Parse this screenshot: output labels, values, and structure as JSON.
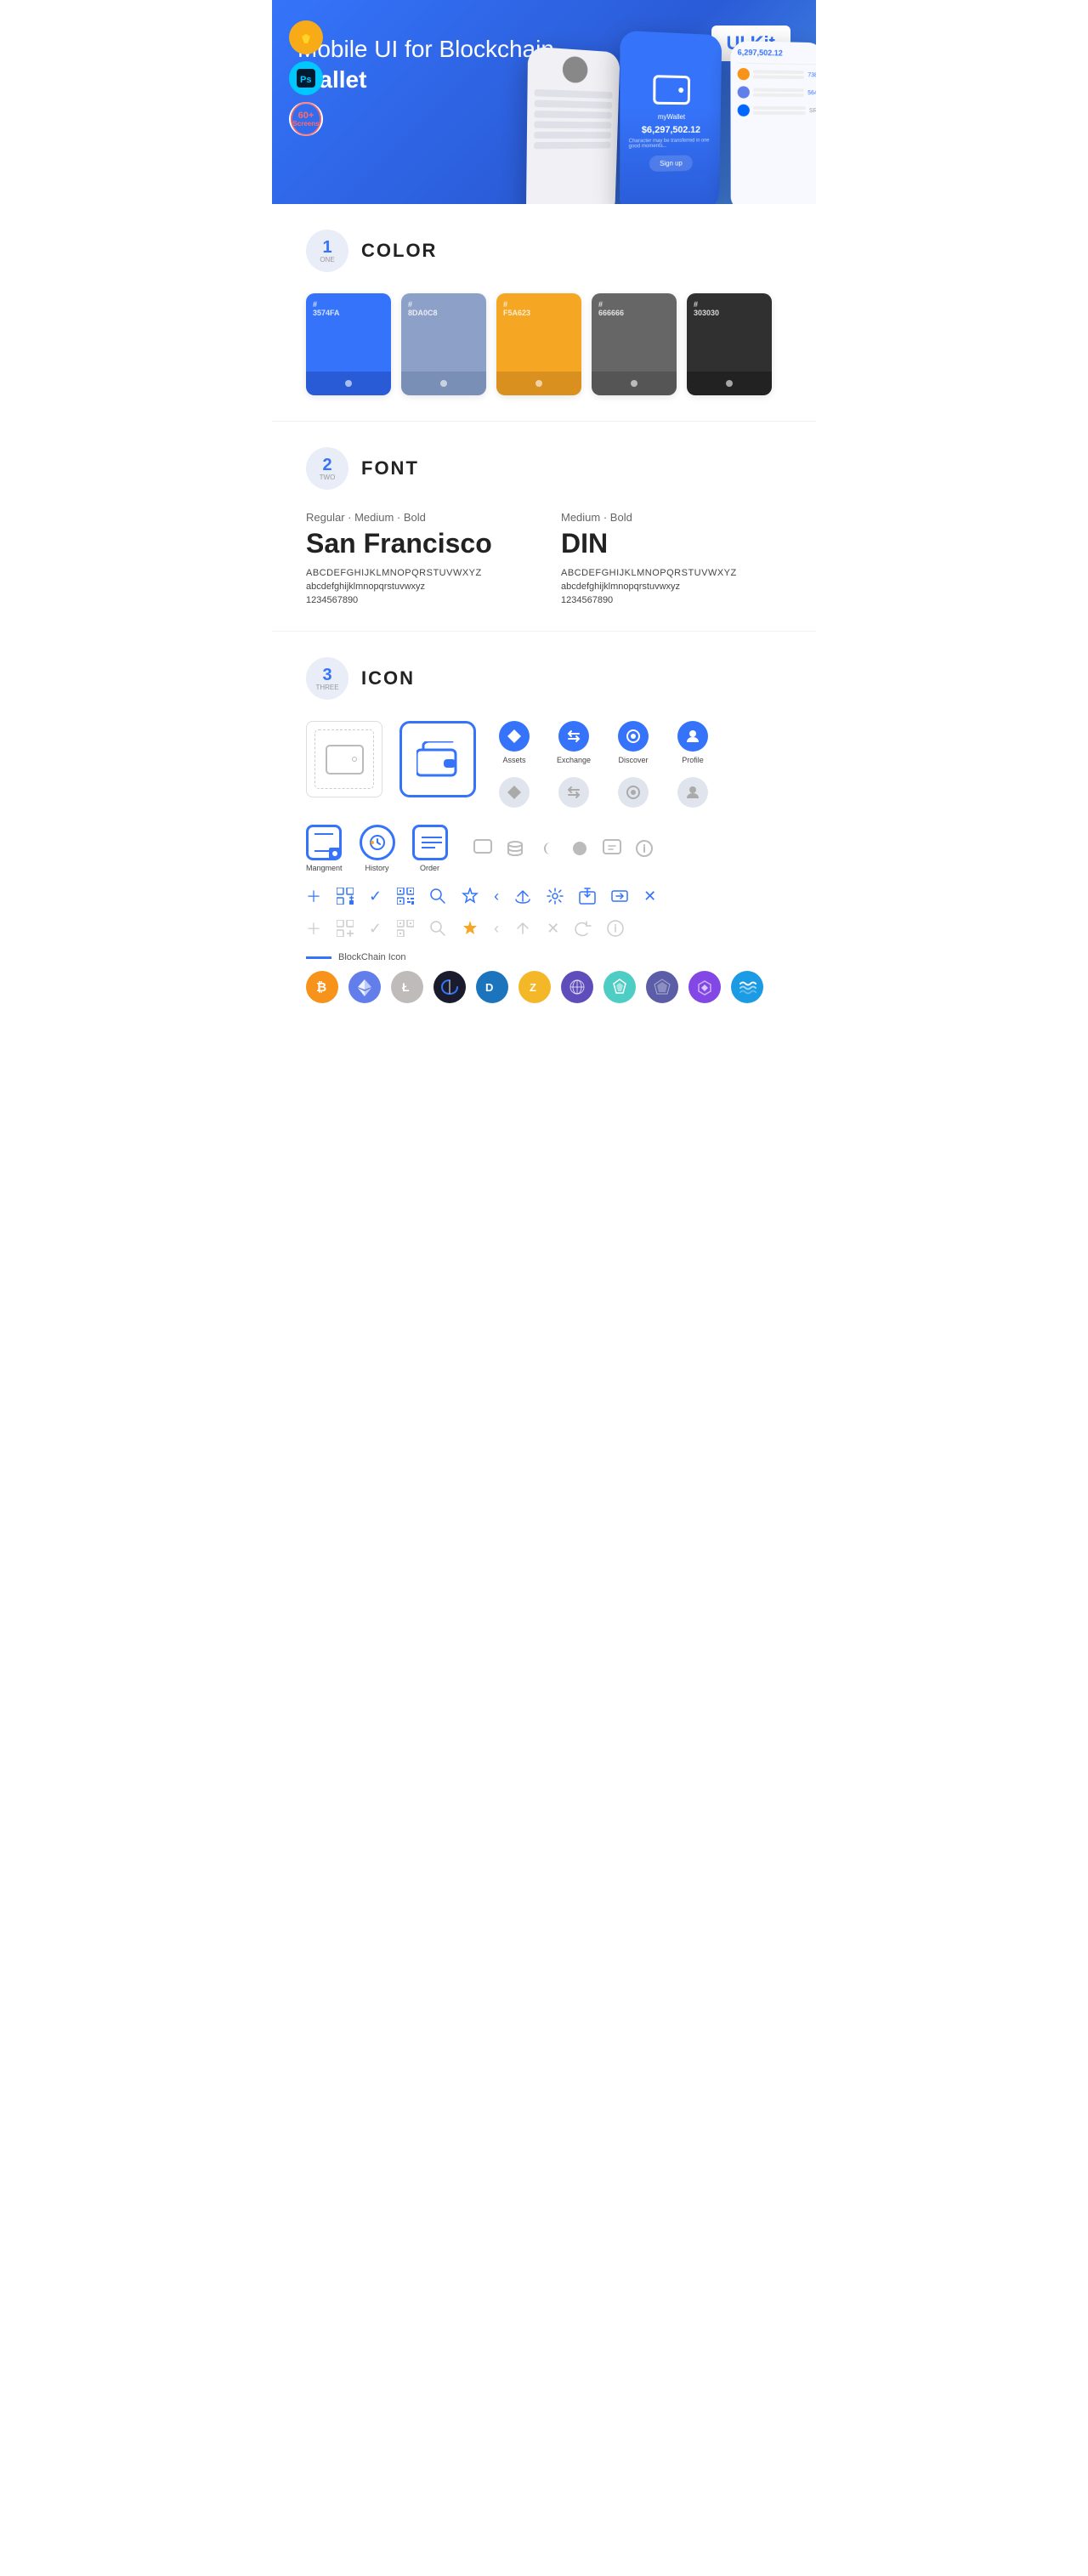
{
  "hero": {
    "title_start": "Mobile UI for Blockchain ",
    "title_bold": "Wallet",
    "badge": "UI Kit",
    "sketch_label": "S",
    "ps_label": "Ps",
    "screens_label": "60+\nScreens"
  },
  "sections": {
    "color": {
      "number": "1",
      "word": "ONE",
      "title": "COLOR",
      "swatches": [
        {
          "hex": "#3574FA",
          "label": "#\n3574FA",
          "bottom_bg": "#2a5bd7"
        },
        {
          "hex": "#8DA0C8",
          "label": "#\n8DA0C8",
          "bottom_bg": "#7a8fb5"
        },
        {
          "hex": "#F5A623",
          "label": "#\nF5A623",
          "bottom_bg": "#d9901e"
        },
        {
          "hex": "#666666",
          "label": "#\n666666",
          "bottom_bg": "#555"
        },
        {
          "hex": "#303030",
          "label": "#\n303030",
          "bottom_bg": "#222"
        }
      ]
    },
    "font": {
      "number": "2",
      "word": "TWO",
      "title": "FONT",
      "left": {
        "style": "Regular · Medium · Bold",
        "name": "San Francisco",
        "upper": "ABCDEFGHIJKLMNOPQRSTUVWXYZ",
        "lower": "abcdefghijklmnopqrstuvwxyz",
        "nums": "1234567890"
      },
      "right": {
        "style": "Medium · Bold",
        "name": "DIN",
        "upper": "ABCDEFGHIJKLMNOPQRSTUVWXYZ",
        "lower": "abcdefghijklmnopqrstuvwxyz",
        "nums": "1234567890"
      }
    },
    "icon": {
      "number": "3",
      "word": "THREE",
      "title": "ICON",
      "icon_labels": {
        "assets": "Assets",
        "exchange": "Exchange",
        "discover": "Discover",
        "profile": "Profile",
        "management": "Mangment",
        "history": "History",
        "order": "Order"
      },
      "blockchain_label": "BlockChain Icon"
    }
  }
}
